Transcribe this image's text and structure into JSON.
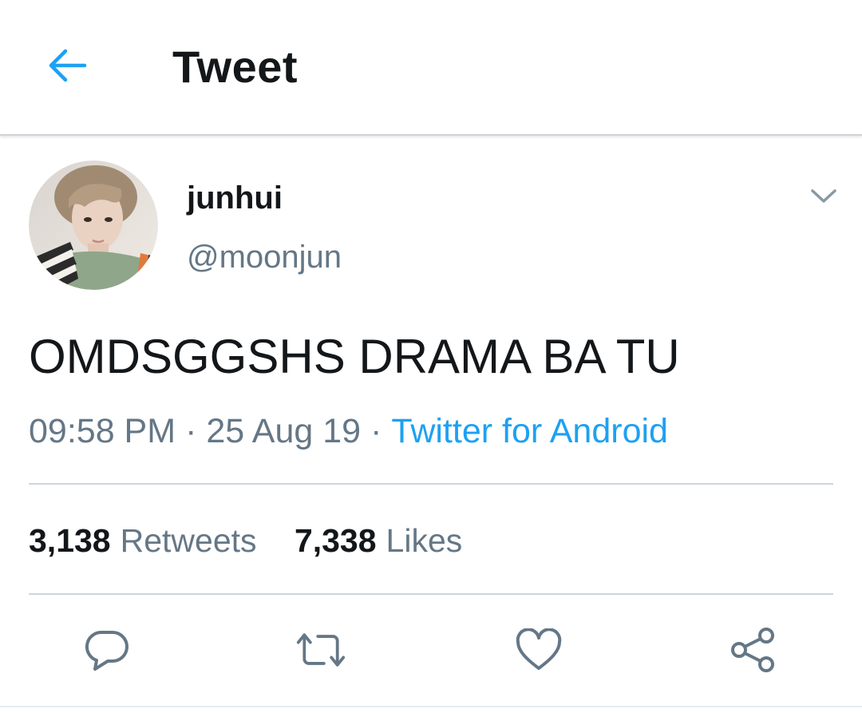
{
  "header": {
    "back_icon": "arrow-left-icon",
    "title": "Tweet",
    "accent_color": "#1da1f2"
  },
  "tweet": {
    "avatar": "user-avatar-photo",
    "display_name": "junhui",
    "handle": "@moonjun",
    "caret_icon": "chevron-down-icon",
    "text": "OMDSGGSHS DRAMA BA TU",
    "time": "09:58 PM",
    "separator": "·",
    "date": "25 Aug 19",
    "source": "Twitter for Android"
  },
  "stats": {
    "retweets_count": "3,138",
    "retweets_label": "Retweets",
    "likes_count": "7,338",
    "likes_label": "Likes"
  },
  "actions": [
    {
      "icon": "reply-icon"
    },
    {
      "icon": "retweet-icon"
    },
    {
      "icon": "heart-icon"
    },
    {
      "icon": "share-icon"
    }
  ],
  "colors": {
    "text_primary": "#14171a",
    "text_secondary": "#657786",
    "link": "#1da1f2",
    "divider": "#ccd6dd"
  }
}
